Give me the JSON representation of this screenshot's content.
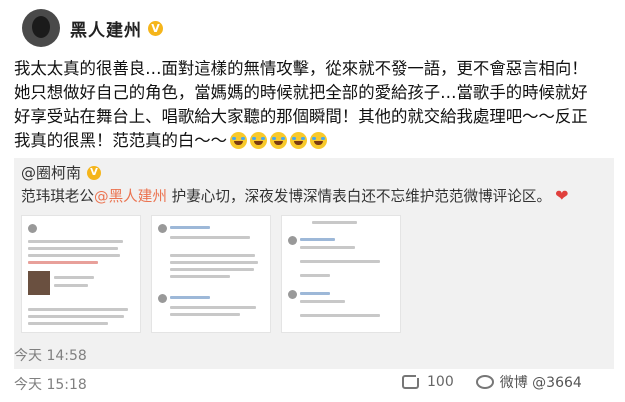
{
  "author": {
    "name": "黑人建州",
    "verified_icon": "v-badge-icon"
  },
  "post": {
    "line1": "我太太真的很善良…面對這樣的無情攻擊，從來就不發一語，更不會惡言相向！",
    "line2": "她只想做好自己的角色，當媽媽的時候就把全部的愛給孩子…當歌手的時候就好",
    "line3": "好享受站在舞台上、唱歌給大家聽的那個瞬間！其他的就交給我處理吧～～反正",
    "line4": "我真的很黑！范范真的白～～"
  },
  "repost": {
    "author": "@圈柯南",
    "text_before": "范玮琪老公",
    "mention": "@黑人建州",
    "text_after": " 护妻心切，深夜发博深情表白还不忘维护范范微博评论区。",
    "heart": "❤"
  },
  "timestamps": {
    "original": "今天 14:58",
    "repost": "今天 15:18"
  },
  "actions": {
    "repost_count": "100",
    "watermark": "微博 @3664"
  },
  "colors": {
    "mention": "#eb7350",
    "verified": "#f5b51b",
    "repost_bg": "#f1f1f1"
  }
}
